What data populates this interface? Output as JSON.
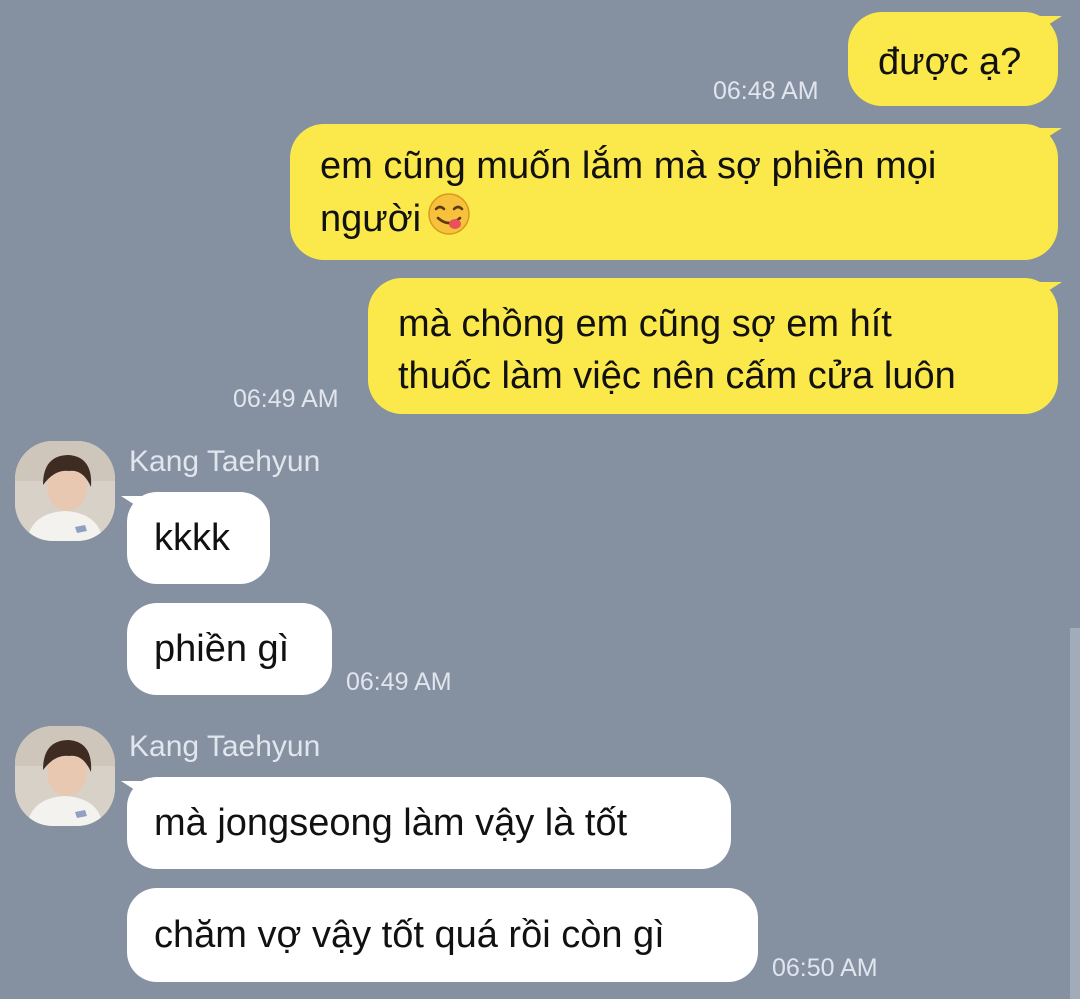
{
  "messages": {
    "m1": {
      "text": "được ạ?",
      "time": "06:48 AM"
    },
    "m2": {
      "line1": "em cũng muốn lắm mà sợ phiền mọi",
      "line2": "người",
      "emoji": "face-savoring-food-emoji"
    },
    "m3": {
      "line1": "mà chồng em cũng sợ em hít",
      "line2": "thuốc làm việc nên cấm cửa luôn",
      "time": "06:49 AM"
    },
    "group1": {
      "sender": "Kang Taehyun",
      "m4": "kkkk",
      "m5": "phiền gì",
      "time": "06:49 AM"
    },
    "group2": {
      "sender": "Kang Taehyun",
      "m6": "mà jongseong làm vậy là tốt",
      "m7": "chăm vợ vậy tốt quá rồi còn gì",
      "time": "06:50 AM"
    }
  },
  "colors": {
    "background": "#8590a1",
    "outgoing_bubble": "#fbe84a",
    "incoming_bubble": "#ffffff",
    "meta_text": "#e1e6ee"
  }
}
